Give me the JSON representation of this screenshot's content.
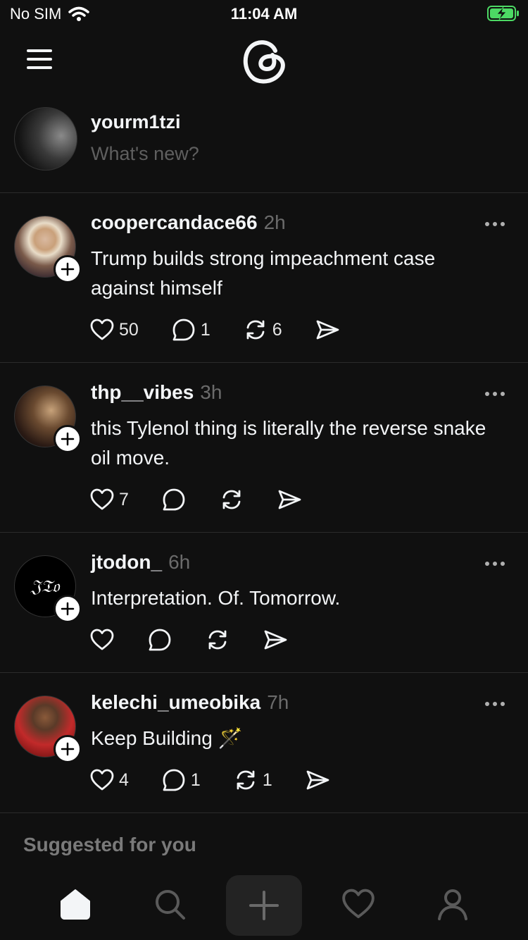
{
  "status": {
    "carrier": "No SIM",
    "time": "11:04 AM"
  },
  "composer": {
    "username": "yourm1tzi",
    "placeholder": "What's new?"
  },
  "posts": [
    {
      "username": "coopercandace66",
      "time": "2h",
      "text": "Trump builds strong impeachment case against himself",
      "likes": "50",
      "replies": "1",
      "reposts": "6"
    },
    {
      "username": "thp__vibes",
      "time": "3h",
      "text": "this Tylenol thing is literally the reverse snake oil move.",
      "likes": "7",
      "replies": "",
      "reposts": ""
    },
    {
      "username": "jtodon_",
      "time": "6h",
      "text": "Interpretation. Of. Tomorrow.",
      "likes": "",
      "replies": "",
      "reposts": ""
    },
    {
      "username": "kelechi_umeobika",
      "time": "7h",
      "text": "Keep Building 🪄",
      "likes": "4",
      "replies": "1",
      "reposts": "1"
    }
  ],
  "jtodon_logo": "𝔍𝔗𝔬",
  "suggested": {
    "label": "Suggested for you"
  },
  "colors": {
    "background": "#101010",
    "text": "#f3f5f7",
    "muted": "#6b6b6b",
    "battery": "#4cd964"
  }
}
